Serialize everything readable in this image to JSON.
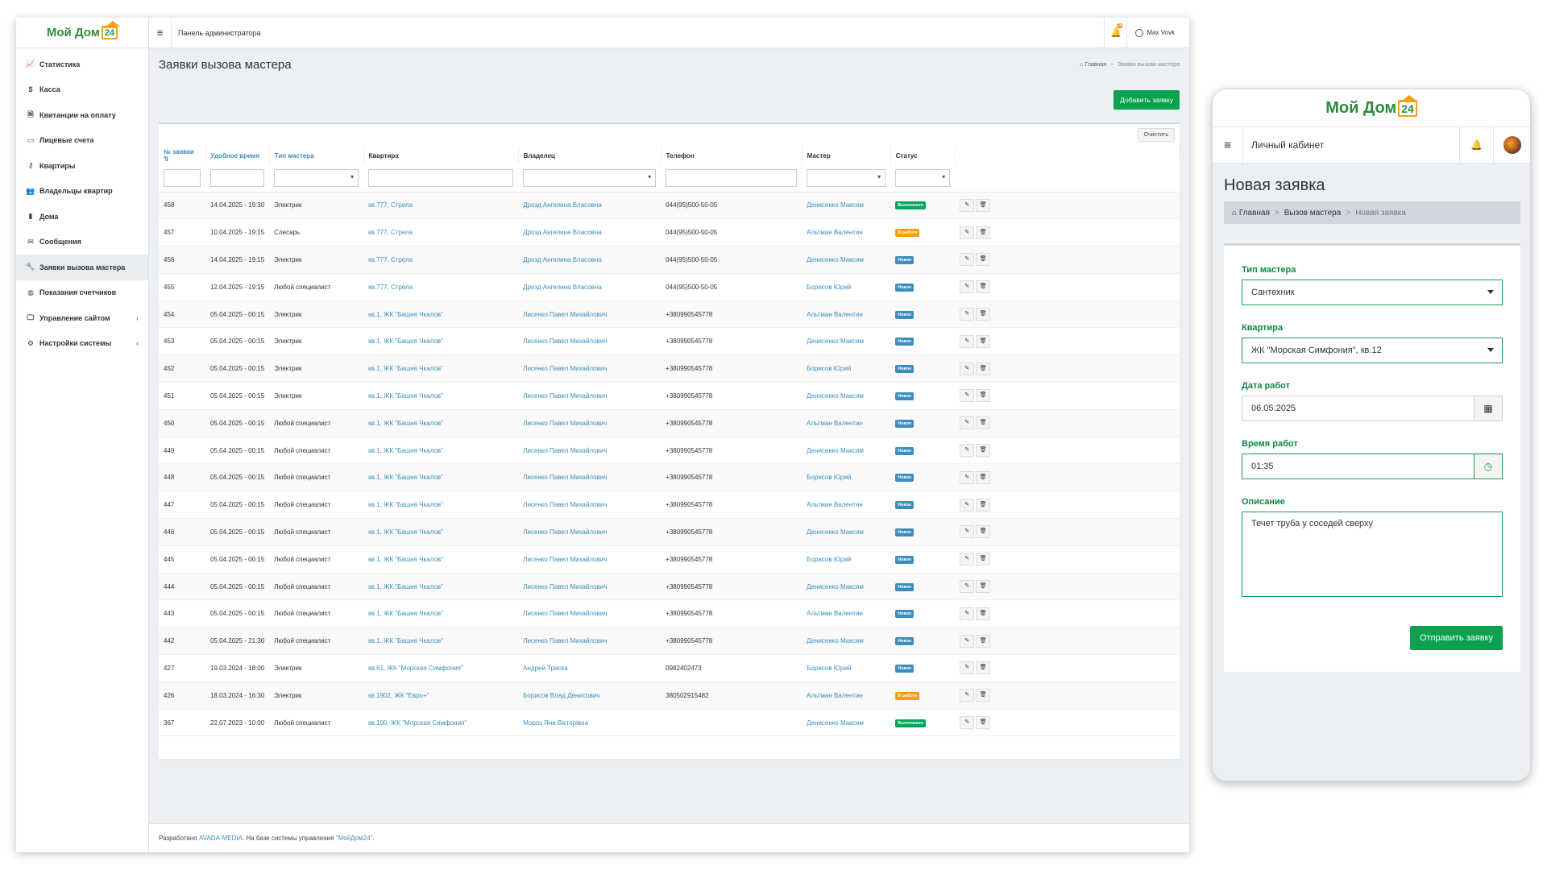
{
  "admin": {
    "logo_text": "Мой Дом",
    "logo_number": "24",
    "topbar": {
      "title": "Панель администратора",
      "bell_count": "24",
      "user": "Max Vovk"
    },
    "sidebar": [
      {
        "icon": "📈",
        "name": "chart-icon",
        "label": "Статистика"
      },
      {
        "icon": "$",
        "name": "dollar-icon",
        "label": "Касса"
      },
      {
        "icon": "🗎",
        "name": "receipt-icon",
        "label": "Квитанции на оплату"
      },
      {
        "icon": "▭",
        "name": "card-icon",
        "label": "Лицевые счета"
      },
      {
        "icon": "⚷",
        "name": "key-icon",
        "label": "Квартиры"
      },
      {
        "icon": "👥",
        "name": "users-icon",
        "label": "Владельцы квартир"
      },
      {
        "icon": "▮",
        "name": "building-icon",
        "label": "Дома"
      },
      {
        "icon": "✉",
        "name": "envelope-icon",
        "label": "Сообщения"
      },
      {
        "icon": "🔧",
        "name": "wrench-icon",
        "label": "Заявки вызова мастера",
        "active": true
      },
      {
        "icon": "◍",
        "name": "meter-icon",
        "label": "Показания счетчиков"
      },
      {
        "icon": "🖵",
        "name": "desktop-icon",
        "label": "Управление сайтом",
        "chevron": "‹"
      },
      {
        "icon": "⚙",
        "name": "cogs-icon",
        "label": "Настройки системы",
        "chevron": "‹"
      }
    ],
    "page_title": "Заявки вызова мастера",
    "breadcrumb": {
      "home": "Главная",
      "current": "Заявки вызова мастера"
    },
    "add_button": "Добавить заявку",
    "clear_button": "Очистить",
    "columns": [
      "№ заявки",
      "Удобное время",
      "Тип мастера",
      "Квартира",
      "Владелец",
      "Телефон",
      "Мастер",
      "Статус"
    ],
    "status_colors": {
      "Выполнено": "#00a65a",
      "В работе": "#f39c12",
      "Новое": "#3c8dbc"
    },
    "rows": [
      [
        "458",
        "14.04.2025 - 19:30",
        "Электрик",
        "кв.777, Стрела",
        "Дрозд Ангелина Власовна",
        "044(95)500-50-05",
        "Денисенко Максим",
        "Выполнено"
      ],
      [
        "457",
        "10.04.2025 - 19:15",
        "Слесарь",
        "кв.777, Стрела",
        "Дрозд Ангелина Власовна",
        "044(95)500-50-05",
        "Альтман Валентин",
        "В работе"
      ],
      [
        "456",
        "14.04.2025 - 19:15",
        "Электрик",
        "кв.777, Стрела",
        "Дрозд Ангелина Власовна",
        "044(95)500-50-05",
        "Денисенко Максим",
        "Новое"
      ],
      [
        "455",
        "12.04.2025 - 19:15",
        "Любой специалист",
        "кв.777, Стрела",
        "Дрозд Ангелина Власовна",
        "044(95)500-50-05",
        "Борисов Юрий",
        "Новое"
      ],
      [
        "454",
        "05.04.2025 - 00:15",
        "Электрик",
        "кв.1, ЖК \"Башня Чкалов\"",
        "Лисенко Павел Михайлович",
        "+380990545778",
        "Альтман Валентин",
        "Новое"
      ],
      [
        "453",
        "05.04.2025 - 00:15",
        "Электрик",
        "кв.1, ЖК \"Башня Чкалов\"",
        "Лисенко Павел Михайлович",
        "+380990545778",
        "Денисенко Максим",
        "Новое"
      ],
      [
        "452",
        "05.04.2025 - 00:15",
        "Электрик",
        "кв.1, ЖК \"Башня Чкалов\"",
        "Лисенко Павел Михайлович",
        "+380990545778",
        "Борисов Юрий",
        "Новое"
      ],
      [
        "451",
        "05.04.2025 - 00:15",
        "Электрик",
        "кв.1, ЖК \"Башня Чкалов\"",
        "Лисенко Павел Михайлович",
        "+380990545778",
        "Денисенко Максим",
        "Новое"
      ],
      [
        "450",
        "05.04.2025 - 00:15",
        "Любой специалист",
        "кв.1, ЖК \"Башня Чкалов\"",
        "Лисенко Павел Михайлович",
        "+380990545778",
        "Альтман Валентин",
        "Новое"
      ],
      [
        "449",
        "05.04.2025 - 00:15",
        "Любой специалист",
        "кв.1, ЖК \"Башня Чкалов\"",
        "Лисенко Павел Михайлович",
        "+380990545778",
        "Денисенко Максим",
        "Новое"
      ],
      [
        "448",
        "05.04.2025 - 00:15",
        "Любой специалист",
        "кв.1, ЖК \"Башня Чкалов\"",
        "Лисенко Павел Михайлович",
        "+380990545778",
        "Борисов Юрий",
        "Новое"
      ],
      [
        "447",
        "05.04.2025 - 00:15",
        "Любой специалист",
        "кв.1, ЖК \"Башня Чкалов\"",
        "Лисенко Павел Михайлович",
        "+380990545778",
        "Альтман Валентин",
        "Новое"
      ],
      [
        "446",
        "05.04.2025 - 00:15",
        "Любой специалист",
        "кв.1, ЖК \"Башня Чкалов\"",
        "Лисенко Павел Михайлович",
        "+380990545778",
        "Денисенко Максим",
        "Новое"
      ],
      [
        "445",
        "05.04.2025 - 00:15",
        "Любой специалист",
        "кв.1, ЖК \"Башня Чкалов\"",
        "Лисенко Павел Михайлович",
        "+380990545778",
        "Борисов Юрий",
        "Новое"
      ],
      [
        "444",
        "05.04.2025 - 00:15",
        "Любой специалист",
        "кв.1, ЖК \"Башня Чкалов\"",
        "Лисенко Павел Михайлович",
        "+380990545778",
        "Денисенко Максим",
        "Новое"
      ],
      [
        "443",
        "05.04.2025 - 00:15",
        "Любой специалист",
        "кв.1, ЖК \"Башня Чкалов\"",
        "Лисенко Павел Михайлович",
        "+380990545778",
        "Альтман Валентин",
        "Новое"
      ],
      [
        "442",
        "05.04.2025 - 21:30",
        "Любой специалист",
        "кв.1, ЖК \"Башня Чкалов\"",
        "Лисенко Павел Михайлович",
        "+380990545778",
        "Денисенко Максим",
        "Новое"
      ],
      [
        "427",
        "19.03.2024 - 18:00",
        "Электрик",
        "кв.61, ЖК \"Морская Симфония\"",
        "Андрей Триска",
        "0982402473",
        "Борисов Юрий",
        "Новое"
      ],
      [
        "426",
        "18.03.2024 - 16:30",
        "Электрик",
        "кв.1902, ЖК \"Евро+\"",
        "Борисов Влад Денисович",
        "380502915482",
        "Альтман Валентин",
        "В работе"
      ],
      [
        "367",
        "22.07.2023 - 10:00",
        "Любой специалист",
        "кв.100, ЖК \"Морская Симфония\"",
        "Мороз Яна Вікторівна",
        "",
        "Денисенко Максим",
        "Выполнено"
      ]
    ],
    "footer": {
      "prefix": "Разработано ",
      "company": "AVADA-MEDIA",
      "middle": ". На базе системы управления ",
      "product": "\"МойДом24\"",
      "suffix": "."
    }
  },
  "mobile": {
    "logo_text": "Мой Дом",
    "logo_number": "24",
    "topbar_title": "Личный кабинет",
    "page_title": "Новая заявка",
    "breadcrumb": {
      "home": "Главная",
      "mid": "Вызов мастера",
      "current": "Новая заявка"
    },
    "form": {
      "master_type_label": "Тип мастера",
      "master_type_value": "Сантехник",
      "apartment_label": "Квартира",
      "apartment_value": "ЖК \"Морская Симфония\", кв.12",
      "date_label": "Дата работ",
      "date_value": "06.05.2025",
      "time_label": "Время работ",
      "time_value": "01:35",
      "description_label": "Описание",
      "description_value": "Течет труба у соседей сверху",
      "submit": "Отправить заявку"
    }
  }
}
